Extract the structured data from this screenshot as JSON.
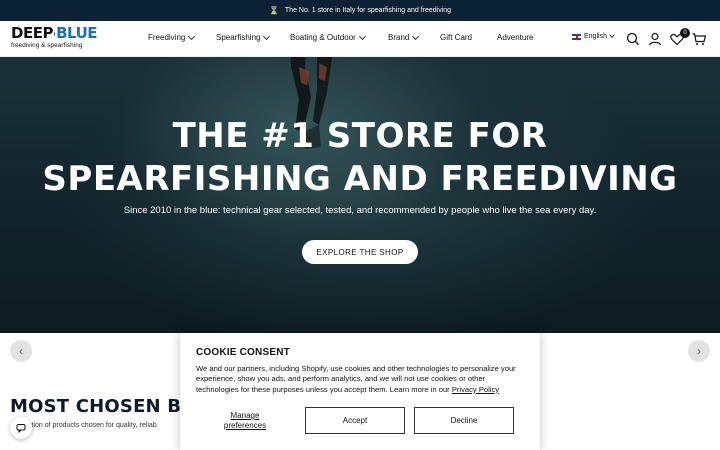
{
  "announcement": {
    "text": "The No. 1 store in Italy for spearfishing and freediving",
    "icon": "hourglass-icon"
  },
  "logo": {
    "part1": "DEEP",
    "part2": "BLUE",
    "tagline": "freediving & spearfishing"
  },
  "nav": {
    "freediving": "Freediving",
    "spearfishing": "Spearfishing",
    "boating": "Boating & Outdoor",
    "brand": "Brand",
    "giftcard": "Gift Card",
    "adventure": "Adventure"
  },
  "language": {
    "label": "English"
  },
  "cart": {
    "wishlist_count": "0"
  },
  "hero": {
    "title_line1": "THE #1 STORE FOR",
    "title_line2": "SPEARFISHING AND FREEDIVING",
    "subtitle": "Since 2010 in the blue: technical gear selected, tested, and recommended by people who live the sea every day.",
    "button": "EXPLORE THE SHOP"
  },
  "section": {
    "title": "MOST CHOSEN BY",
    "subtitle": "ction of products chosen for quality, reliab"
  },
  "cookie": {
    "title": "COOKIE CONSENT",
    "text": "We and our partners, including Shopify, use cookies and other technologies to personalize your experience, show you ads, and perform analytics, and we will not use cookies or other technologies for these purposes unless you accept them. Learn more in our",
    "link": "Privacy Policy",
    "manage": "Manage preferences",
    "accept": "Accept",
    "decline": "Decline"
  },
  "colors": {
    "announce_bg": "#0b2235",
    "brand_blue": "#1b6fb5",
    "title_navy": "#0d1b2a"
  }
}
